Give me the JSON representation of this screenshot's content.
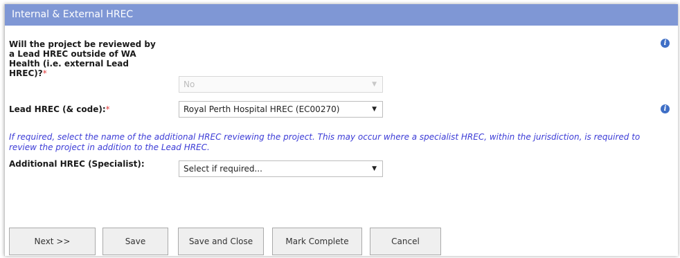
{
  "section": {
    "title": "Internal & External HREC"
  },
  "fields": {
    "external_lead": {
      "label_lines": [
        "Will the project be reviewed by",
        "a Lead HREC outside of WA",
        "Health (i.e. external Lead",
        "HREC)?"
      ],
      "required_mark": "*",
      "value": "No",
      "disabled": true
    },
    "lead_hrec": {
      "label": "Lead HREC (& code):",
      "required_mark": "*",
      "value": "Royal Perth Hospital HREC (EC00270)"
    },
    "note": "If required, select the name of the additional HREC reviewing the project. This may occur where a specialist HREC, within the jurisdiction, is required to review the project in addition to the Lead HREC.",
    "additional_hrec": {
      "label": "Additional HREC (Specialist):",
      "value": "Select if required..."
    }
  },
  "icons": {
    "info": "i",
    "dropdown_arrow": "▼"
  },
  "buttons": {
    "next": "Next >>",
    "save": "Save",
    "save_close": "Save and Close",
    "mark_complete": "Mark Complete",
    "cancel": "Cancel"
  },
  "colors": {
    "header_bg": "#7f97d5",
    "note_text": "#3b3bd6",
    "required": "#e03a3a",
    "info_icon": "#3f6fc6"
  }
}
